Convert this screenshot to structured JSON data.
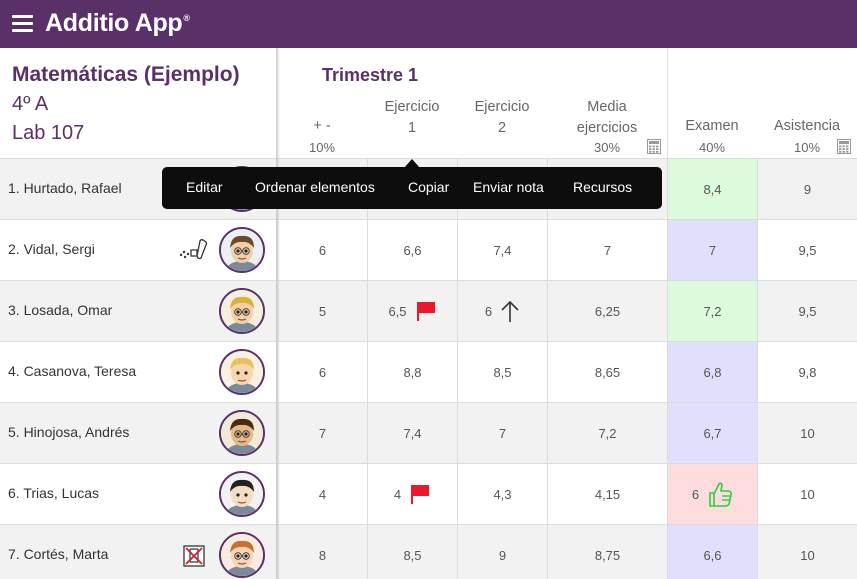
{
  "app": {
    "title": "Additio App",
    "trademark": "®"
  },
  "class_info": {
    "name": "Matemáticas (Ejemplo)",
    "group": "4º A",
    "room": "Lab 107"
  },
  "term": {
    "title": "Trimestre 1"
  },
  "columns": [
    {
      "line1": "",
      "line2": "+ -",
      "weight": "10%",
      "calc": false
    },
    {
      "line1": "Ejercicio",
      "line2": "1",
      "weight": "",
      "calc": false
    },
    {
      "line1": "Ejercicio",
      "line2": "2",
      "weight": "",
      "calc": false
    },
    {
      "line1": "Media",
      "line2": "ejercicios",
      "weight": "30%",
      "calc": true
    },
    {
      "line1": "",
      "line2": "Examen",
      "weight": "40%",
      "calc": false
    },
    {
      "line1": "",
      "line2": "Asistencia",
      "weight": "10%",
      "calc": true
    }
  ],
  "popup_menu": {
    "items": [
      "Editar",
      "Ordenar elementos",
      "Copiar",
      "Enviar nota",
      "Recursos"
    ]
  },
  "students": [
    {
      "name": "1. Hurtado, Rafael",
      "avatar": "avatar-rafael",
      "values": [
        "",
        "",
        "",
        "",
        "8,4",
        "9"
      ],
      "exam_color": "green",
      "flags": []
    },
    {
      "name": "2. Vidal, Sergi",
      "avatar": "avatar-sergi",
      "values": [
        "6",
        "6,6",
        "7,4",
        "7",
        "7",
        "9,5"
      ],
      "exam_color": "blue",
      "icon": "inhaler-icon",
      "flags": []
    },
    {
      "name": "3. Losada, Omar",
      "avatar": "avatar-omar",
      "values": [
        "5",
        "6,5",
        "6",
        "6,25",
        "7,2",
        "9,5"
      ],
      "exam_color": "green",
      "flags": [
        "flag-col1",
        "arrow-col2"
      ]
    },
    {
      "name": "4. Casanova, Teresa",
      "avatar": "avatar-teresa",
      "values": [
        "6",
        "8,8",
        "8,5",
        "8,65",
        "6,8",
        "9,8"
      ],
      "exam_color": "blue",
      "flags": []
    },
    {
      "name": "5. Hinojosa, Andrés",
      "avatar": "avatar-andres",
      "values": [
        "7",
        "7,4",
        "7",
        "7,2",
        "6,7",
        "10"
      ],
      "exam_color": "blue",
      "flags": []
    },
    {
      "name": "6. Trias, Lucas",
      "avatar": "avatar-lucas",
      "values": [
        "4",
        "4",
        "4,3",
        "4,15",
        "6",
        "10"
      ],
      "exam_color": "red",
      "flags": [
        "flag-col1",
        "thumb-col4"
      ]
    },
    {
      "name": "7. Cortés, Marta",
      "avatar": "avatar-marta",
      "values": [
        "8",
        "8,5",
        "9",
        "8,75",
        "6,6",
        "10"
      ],
      "exam_color": "blue",
      "icon": "no-phone-icon",
      "flags": []
    }
  ],
  "colors": {
    "brand": "#5a3068",
    "exam_green": "#dcfadc",
    "exam_blue": "#e0e0fc",
    "exam_red": "#fcdcdc",
    "flag": "#e8192c",
    "thumb": "#2ecc40"
  }
}
